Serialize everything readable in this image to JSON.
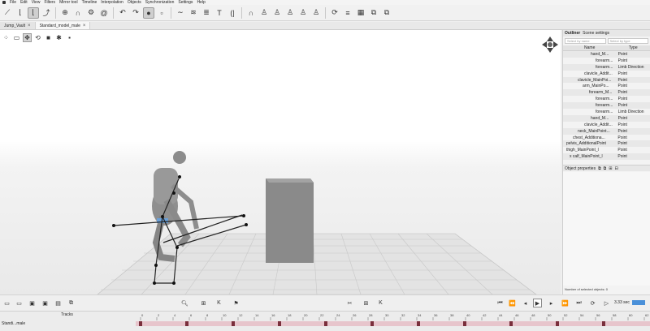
{
  "menu": [
    "File",
    "Edit",
    "View",
    "Filters",
    "Mirror tool",
    "Timeline",
    "Interpolation",
    "Objects",
    "Synchronization",
    "Settings",
    "Help"
  ],
  "tabs": [
    {
      "label": "Jump_Vault",
      "active": false
    },
    {
      "label": "Standard_model_male",
      "active": true
    }
  ],
  "outliner": {
    "tabs": [
      "Outliner",
      "Scene settings"
    ],
    "search_name_placeholder": "Select by name",
    "search_type_placeholder": "Select by type",
    "columns": [
      "Name",
      "Type"
    ],
    "rows": [
      {
        "name": "hand_M...",
        "type": "Point",
        "indent": 34
      },
      {
        "name": "forearm...",
        "type": "Point",
        "indent": 40
      },
      {
        "name": "forearm...",
        "type": "Limb Direction",
        "indent": 40
      },
      {
        "name": "clavicle_Addit...",
        "type": "Point",
        "indent": 26
      },
      {
        "name": "clavicle_MainPoi...",
        "type": "Point",
        "indent": 18
      },
      {
        "name": "arm_MainPo...",
        "type": "Point",
        "indent": 24
      },
      {
        "name": "forearm_M...",
        "type": "Point",
        "indent": 32
      },
      {
        "name": "forearm...",
        "type": "Point",
        "indent": 40
      },
      {
        "name": "forearm...",
        "type": "Point",
        "indent": 40
      },
      {
        "name": "forearm...",
        "type": "Limb Direction",
        "indent": 40
      },
      {
        "name": "hand_M...",
        "type": "Point",
        "indent": 34
      },
      {
        "name": "clavicle_Addit...",
        "type": "Point",
        "indent": 26
      },
      {
        "name": "neck_MainPoint...",
        "type": "Point",
        "indent": 18
      },
      {
        "name": "chest_Additiona...",
        "type": "Point",
        "indent": 12
      },
      {
        "name": "pelvis_AdditionalPoint",
        "type": "Point",
        "indent": 4
      },
      {
        "name": "thigh_MainPoint_l",
        "type": "Point",
        "indent": 4
      },
      {
        "name": "x calf_MainPoint_l",
        "type": "Point",
        "indent": 8
      }
    ],
    "properties_title": "Object properties",
    "status": "Number of selected objects: 0"
  },
  "tracks": {
    "header": "Tracks",
    "track_name": "Standi...male",
    "ruler_ticks": [
      "0",
      "2",
      "4",
      "6",
      "8",
      "10",
      "12",
      "14",
      "16",
      "18",
      "20",
      "22",
      "24",
      "26",
      "28",
      "30",
      "32",
      "34",
      "36",
      "38",
      "40",
      "42",
      "44",
      "46",
      "48",
      "50",
      "52",
      "54",
      "56",
      "58",
      "60",
      "62"
    ]
  },
  "playback": {
    "time": "3.33 sec"
  },
  "colors": {
    "accent": "#4a90d9",
    "keyframe": "#7a2f3c",
    "track": "#e7c5cc",
    "box": "#8a8a8a"
  },
  "icons": [
    "select-icon",
    "move-icon",
    "rotate-icon",
    "play-icon",
    "record-flag-icon",
    "zoom-icon"
  ]
}
